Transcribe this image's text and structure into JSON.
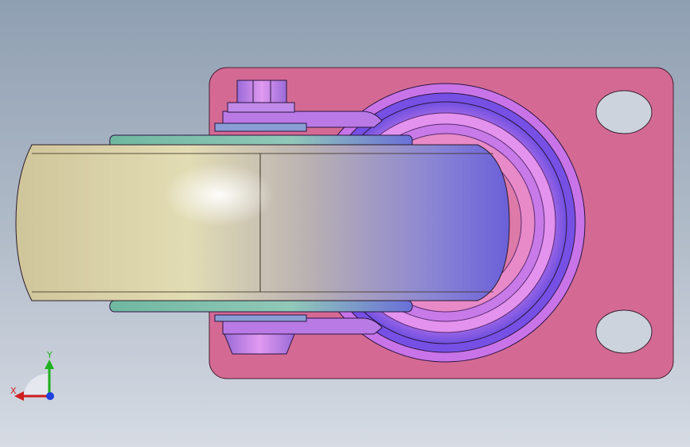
{
  "viewport": {
    "background_top": "#8f9fb2",
    "background_bottom": "#d6dbe4"
  },
  "model": {
    "part_colors": {
      "mounting_plate": "#d46a94",
      "swivel_ring": "#b070e8",
      "wheel_tread": "#d8d2a4",
      "hub_plate": "#7ec0a8",
      "bolt_head": "#c882ea"
    }
  },
  "triad": {
    "x_label": "X",
    "y_label": "Y",
    "x_color": "#d02020",
    "y_color": "#20b020",
    "z_color": "#2040e0"
  }
}
